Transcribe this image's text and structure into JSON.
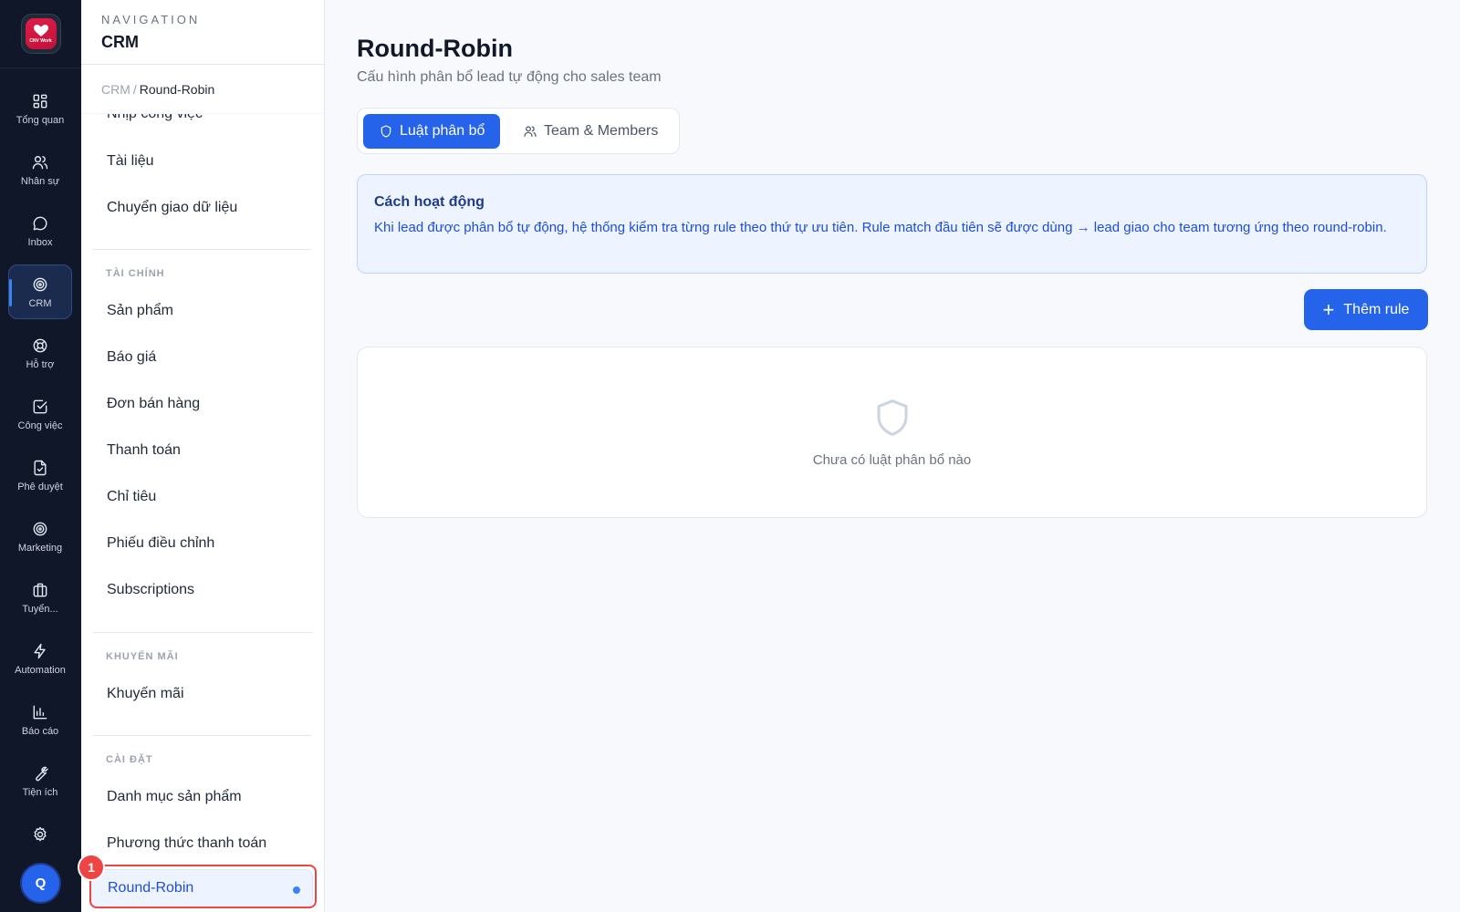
{
  "rail": {
    "logo_text": "CNV Work",
    "items": [
      {
        "label": "Tổng quan",
        "icon": "dashboard-grid-icon"
      },
      {
        "label": "Nhân sự",
        "icon": "users-icon"
      },
      {
        "label": "Inbox",
        "icon": "chat-bubble-icon"
      },
      {
        "label": "CRM",
        "icon": "target-icon"
      },
      {
        "label": "Hỗ trợ",
        "icon": "lifebuoy-icon"
      },
      {
        "label": "Công việc",
        "icon": "checkbox-icon"
      },
      {
        "label": "Phê duyệt",
        "icon": "document-check-icon"
      },
      {
        "label": "Marketing",
        "icon": "target-icon"
      },
      {
        "label": "Tuyển...",
        "icon": "briefcase-icon"
      },
      {
        "label": "Automation",
        "icon": "lightning-icon"
      },
      {
        "label": "Báo cáo",
        "icon": "bar-chart-icon"
      },
      {
        "label": "Tiện ích",
        "icon": "wrench-icon"
      }
    ],
    "avatar_initial": "Q"
  },
  "nav": {
    "eyebrow": "NAVIGATION",
    "title": "CRM",
    "breadcrumb": {
      "root": "CRM",
      "separator": "/",
      "current": "Round-Robin"
    },
    "items_top": [
      "Nhịp công việc",
      "Tài liệu",
      "Chuyển giao dữ liệu"
    ],
    "section_finance": "TÀI CHÍNH",
    "items_finance": [
      "Sản phẩm",
      "Báo giá",
      "Đơn bán hàng",
      "Thanh toán",
      "Chỉ tiêu",
      "Phiếu điều chỉnh",
      "Subscriptions"
    ],
    "section_promo": "KHUYẾN MÃI",
    "items_promo": [
      "Khuyến mãi"
    ],
    "section_settings": "CÀI ĐẶT",
    "items_settings": [
      "Danh mục sản phẩm",
      "Phương thức thanh toán"
    ],
    "active_item": "Round-Robin",
    "step_badge": "1"
  },
  "main": {
    "title": "Round-Robin",
    "subtitle": "Cấu hình phân bổ lead tự động cho sales team",
    "tabs": [
      {
        "label": "Luật phân bổ",
        "icon": "shield-icon",
        "active": true
      },
      {
        "label": "Team & Members",
        "icon": "users-icon",
        "active": false
      }
    ],
    "info": {
      "title": "Cách hoạt động",
      "body": "Khi lead được phân bổ tự động, hệ thống kiểm tra từng rule theo thứ tự ưu tiên. Rule match đầu tiên sẽ được dùng → lead giao cho team tương ứng theo round-robin."
    },
    "add_button": "Thêm rule",
    "empty_text": "Chưa có luật phân bổ nào"
  },
  "colors": {
    "rail_bg": "#0f1729",
    "accent": "#2563eb",
    "highlight": "#ef4444"
  }
}
